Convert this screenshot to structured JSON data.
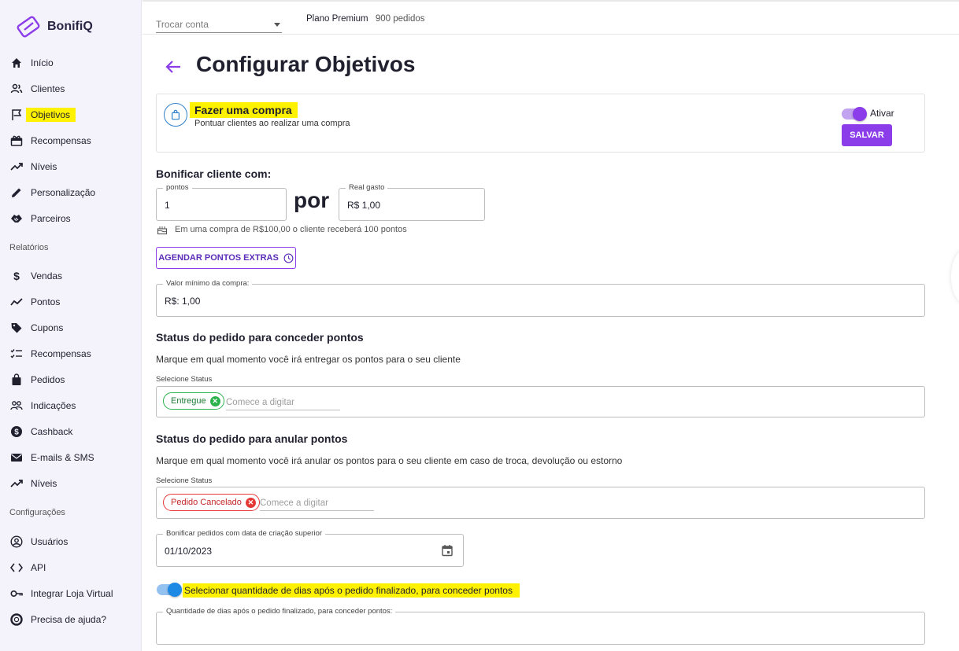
{
  "brand": {
    "name": "BonifiQ",
    "accent": "#8b3dea",
    "highlight": "#fff200"
  },
  "sidebar": {
    "items": [
      {
        "label": "Início",
        "icon": "home-icon"
      },
      {
        "label": "Clientes",
        "icon": "users-icon"
      },
      {
        "label": "Objetivos",
        "icon": "flag-icon",
        "active": true
      },
      {
        "label": "Recompensas",
        "icon": "gift-icon"
      },
      {
        "label": "Níveis",
        "icon": "trending-up-icon"
      },
      {
        "label": "Personalização",
        "icon": "pencil-icon"
      },
      {
        "label": "Parceiros",
        "icon": "handshake-icon"
      }
    ],
    "reports_label": "Relatórios",
    "reports": [
      {
        "label": "Vendas",
        "icon": "dollar-icon"
      },
      {
        "label": "Pontos",
        "icon": "chart-line-icon"
      },
      {
        "label": "Cupons",
        "icon": "tag-icon"
      },
      {
        "label": "Recompensas",
        "icon": "checklist-icon"
      },
      {
        "label": "Pedidos",
        "icon": "shopping-bag-icon"
      },
      {
        "label": "Indicações",
        "icon": "people-icon"
      },
      {
        "label": "Cashback",
        "icon": "coin-icon"
      },
      {
        "label": "E-mails & SMS",
        "icon": "mail-icon"
      },
      {
        "label": "Níveis",
        "icon": "trending-up-icon"
      }
    ],
    "settings_label": "Configurações",
    "settings": [
      {
        "label": "Usuários",
        "icon": "user-circle-icon"
      },
      {
        "label": "API",
        "icon": "code-icon"
      },
      {
        "label": "Integrar Loja Virtual",
        "icon": "key-icon"
      },
      {
        "label": "Precisa de ajuda?",
        "icon": "lifebuoy-icon"
      }
    ]
  },
  "topbar": {
    "account_placeholder": "Trocar conta",
    "plan_name": "Plano Premium",
    "plan_orders": "900 pedidos"
  },
  "page": {
    "title": "Configurar Objetivos"
  },
  "objective": {
    "title": "Fazer uma compra",
    "description": "Pontuar clientes ao realizar uma compra",
    "toggle_label": "Ativar",
    "save_label": "SALVAR"
  },
  "bonus": {
    "heading": "Bonificar cliente com:",
    "points_label": "pontos",
    "points_value": "1",
    "per_label": "por",
    "spent_label": "Real gasto",
    "spent_value": "R$  1,00",
    "hint": "Em uma compra de R$100,00 o cliente receberá 100 pontos",
    "schedule_button": "AGENDAR PONTOS EXTRAS"
  },
  "min_purchase": {
    "label": "Valor mínimo da compra:",
    "value": "R$:  1,00"
  },
  "grant_status": {
    "heading": "Status do pedido para conceder pontos",
    "description": "Marque em qual momento você irá entregar os pontos para o seu cliente",
    "select_label": "Selecione Status",
    "chip": "Entregue",
    "placeholder": "Comece a digitar"
  },
  "cancel_status": {
    "heading": "Status do pedido para anular pontos",
    "description": "Marque em qual momento você irá anular os pontos para o seu cliente em caso de troca, devolução ou estorno",
    "select_label": "Selecione Status",
    "chip": "Pedido Cancelado",
    "placeholder": "Comece a digitar"
  },
  "creation_date": {
    "label": "Bonificar pedidos com data de criação superior",
    "value": "01/10/2023"
  },
  "days_option": {
    "toggle_label": "Selecionar quantidade de dias após o pedido finalizado, para conceder pontos",
    "field_label": "Quantidade de dias após o pedido finalizado, para conceder pontos:",
    "field_value": ""
  }
}
